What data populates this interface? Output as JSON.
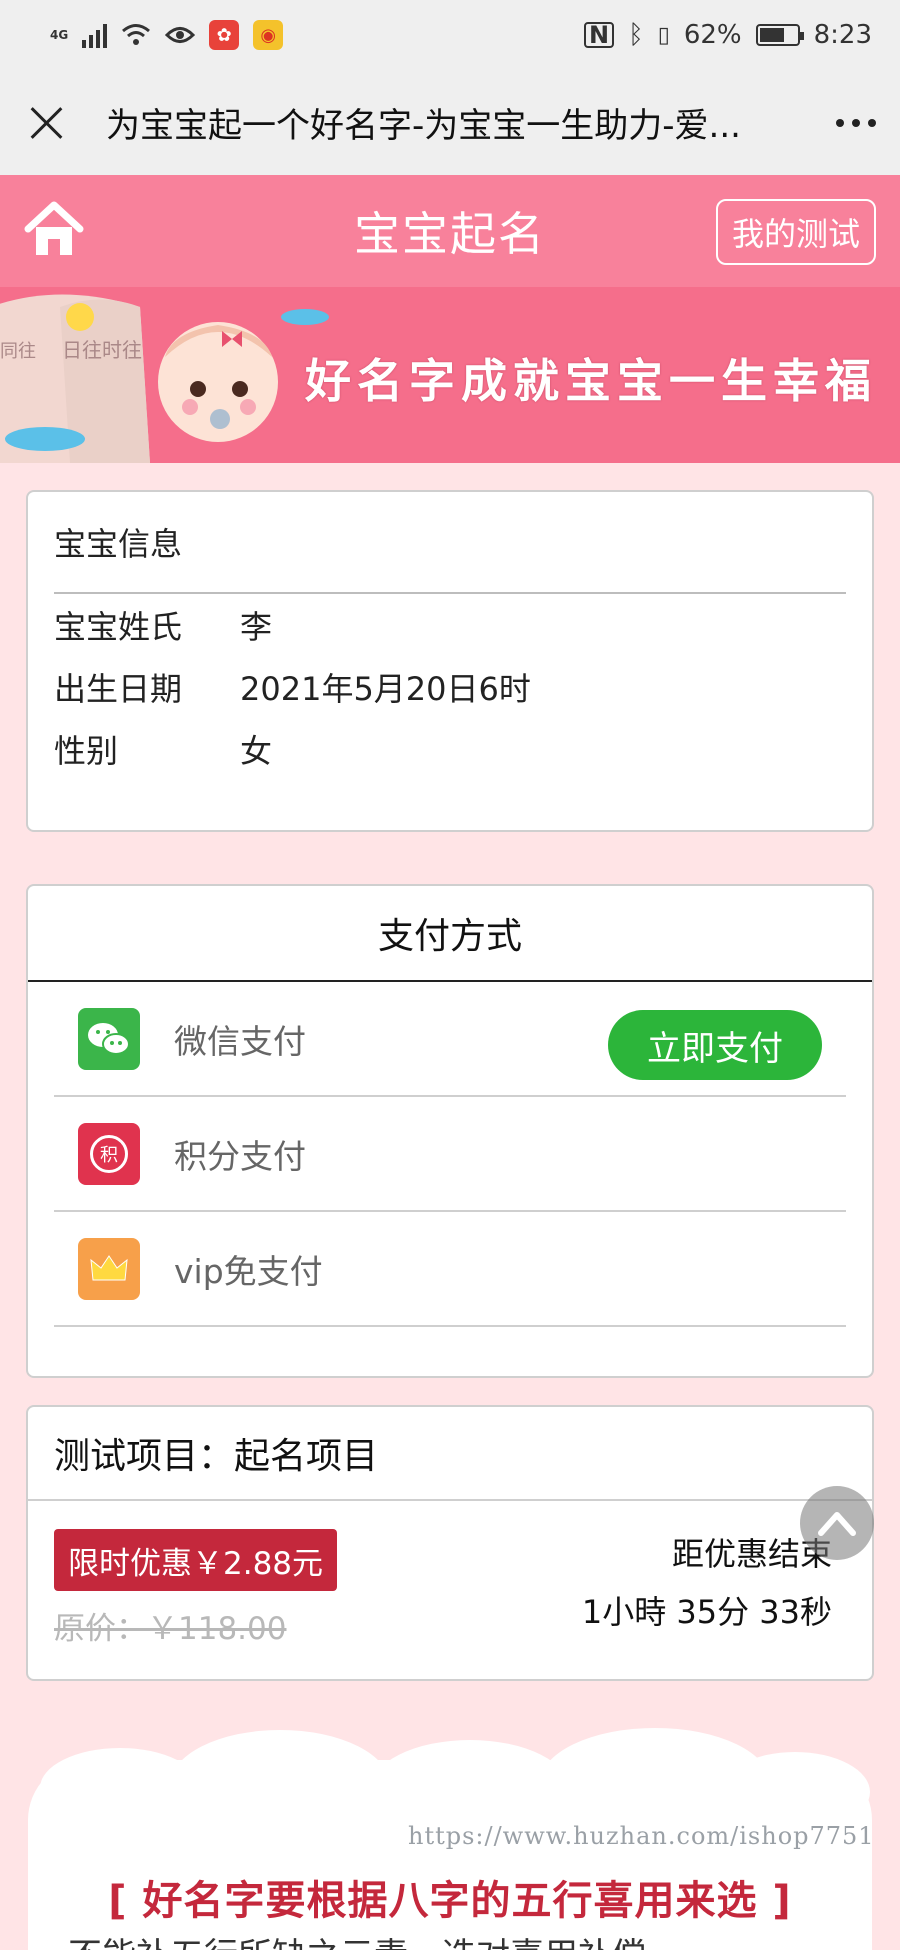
{
  "status_bar": {
    "network": "4G",
    "battery": "62%",
    "time": "8:23"
  },
  "webview": {
    "title": "为宝宝起一个好名字-为宝宝一生助力-爱..."
  },
  "header": {
    "title": "宝宝起名",
    "my_test_label": "我的测试"
  },
  "banner": {
    "slogan": "好名字成就宝宝一生幸福",
    "book_text_1": "日往时往",
    "book_text_2": "同往"
  },
  "baby_info": {
    "heading": "宝宝信息",
    "rows": [
      {
        "label": "宝宝姓氏",
        "value": "李"
      },
      {
        "label": "出生日期",
        "value": "2021年5月20日6时"
      },
      {
        "label": "性别",
        "value": "女"
      }
    ]
  },
  "payment": {
    "heading": "支付方式",
    "methods": [
      {
        "label": "微信支付",
        "icon": "wechat-icon",
        "color": "#3bb54a"
      },
      {
        "label": "积分支付",
        "icon": "points-icon",
        "icon_text": "积",
        "color": "#e0334e"
      },
      {
        "label": "vip免支付",
        "icon": "crown-icon",
        "color": "#f7a04a"
      }
    ],
    "pay_now_label": "立即支付"
  },
  "test_item": {
    "heading": "测试项目：起名项目",
    "promo_label": "限时优惠￥2.88元",
    "original_price": "原价：￥118.00",
    "countdown_label": "距优惠结束",
    "countdown_value": "1小時 35分 33秒"
  },
  "footer": {
    "watermark": "https://www.huzhan.com/ishop7751",
    "tip_title": "[ 好名字要根据八字的五行喜用来选 ]",
    "tip_sub": "不能补五行所缺之元素，选对喜用补偿"
  },
  "colors": {
    "header_pink": "#f8819b",
    "page_bg": "#ffe4e6",
    "pay_green": "#2cb53a",
    "promo_red": "#c4283c"
  }
}
